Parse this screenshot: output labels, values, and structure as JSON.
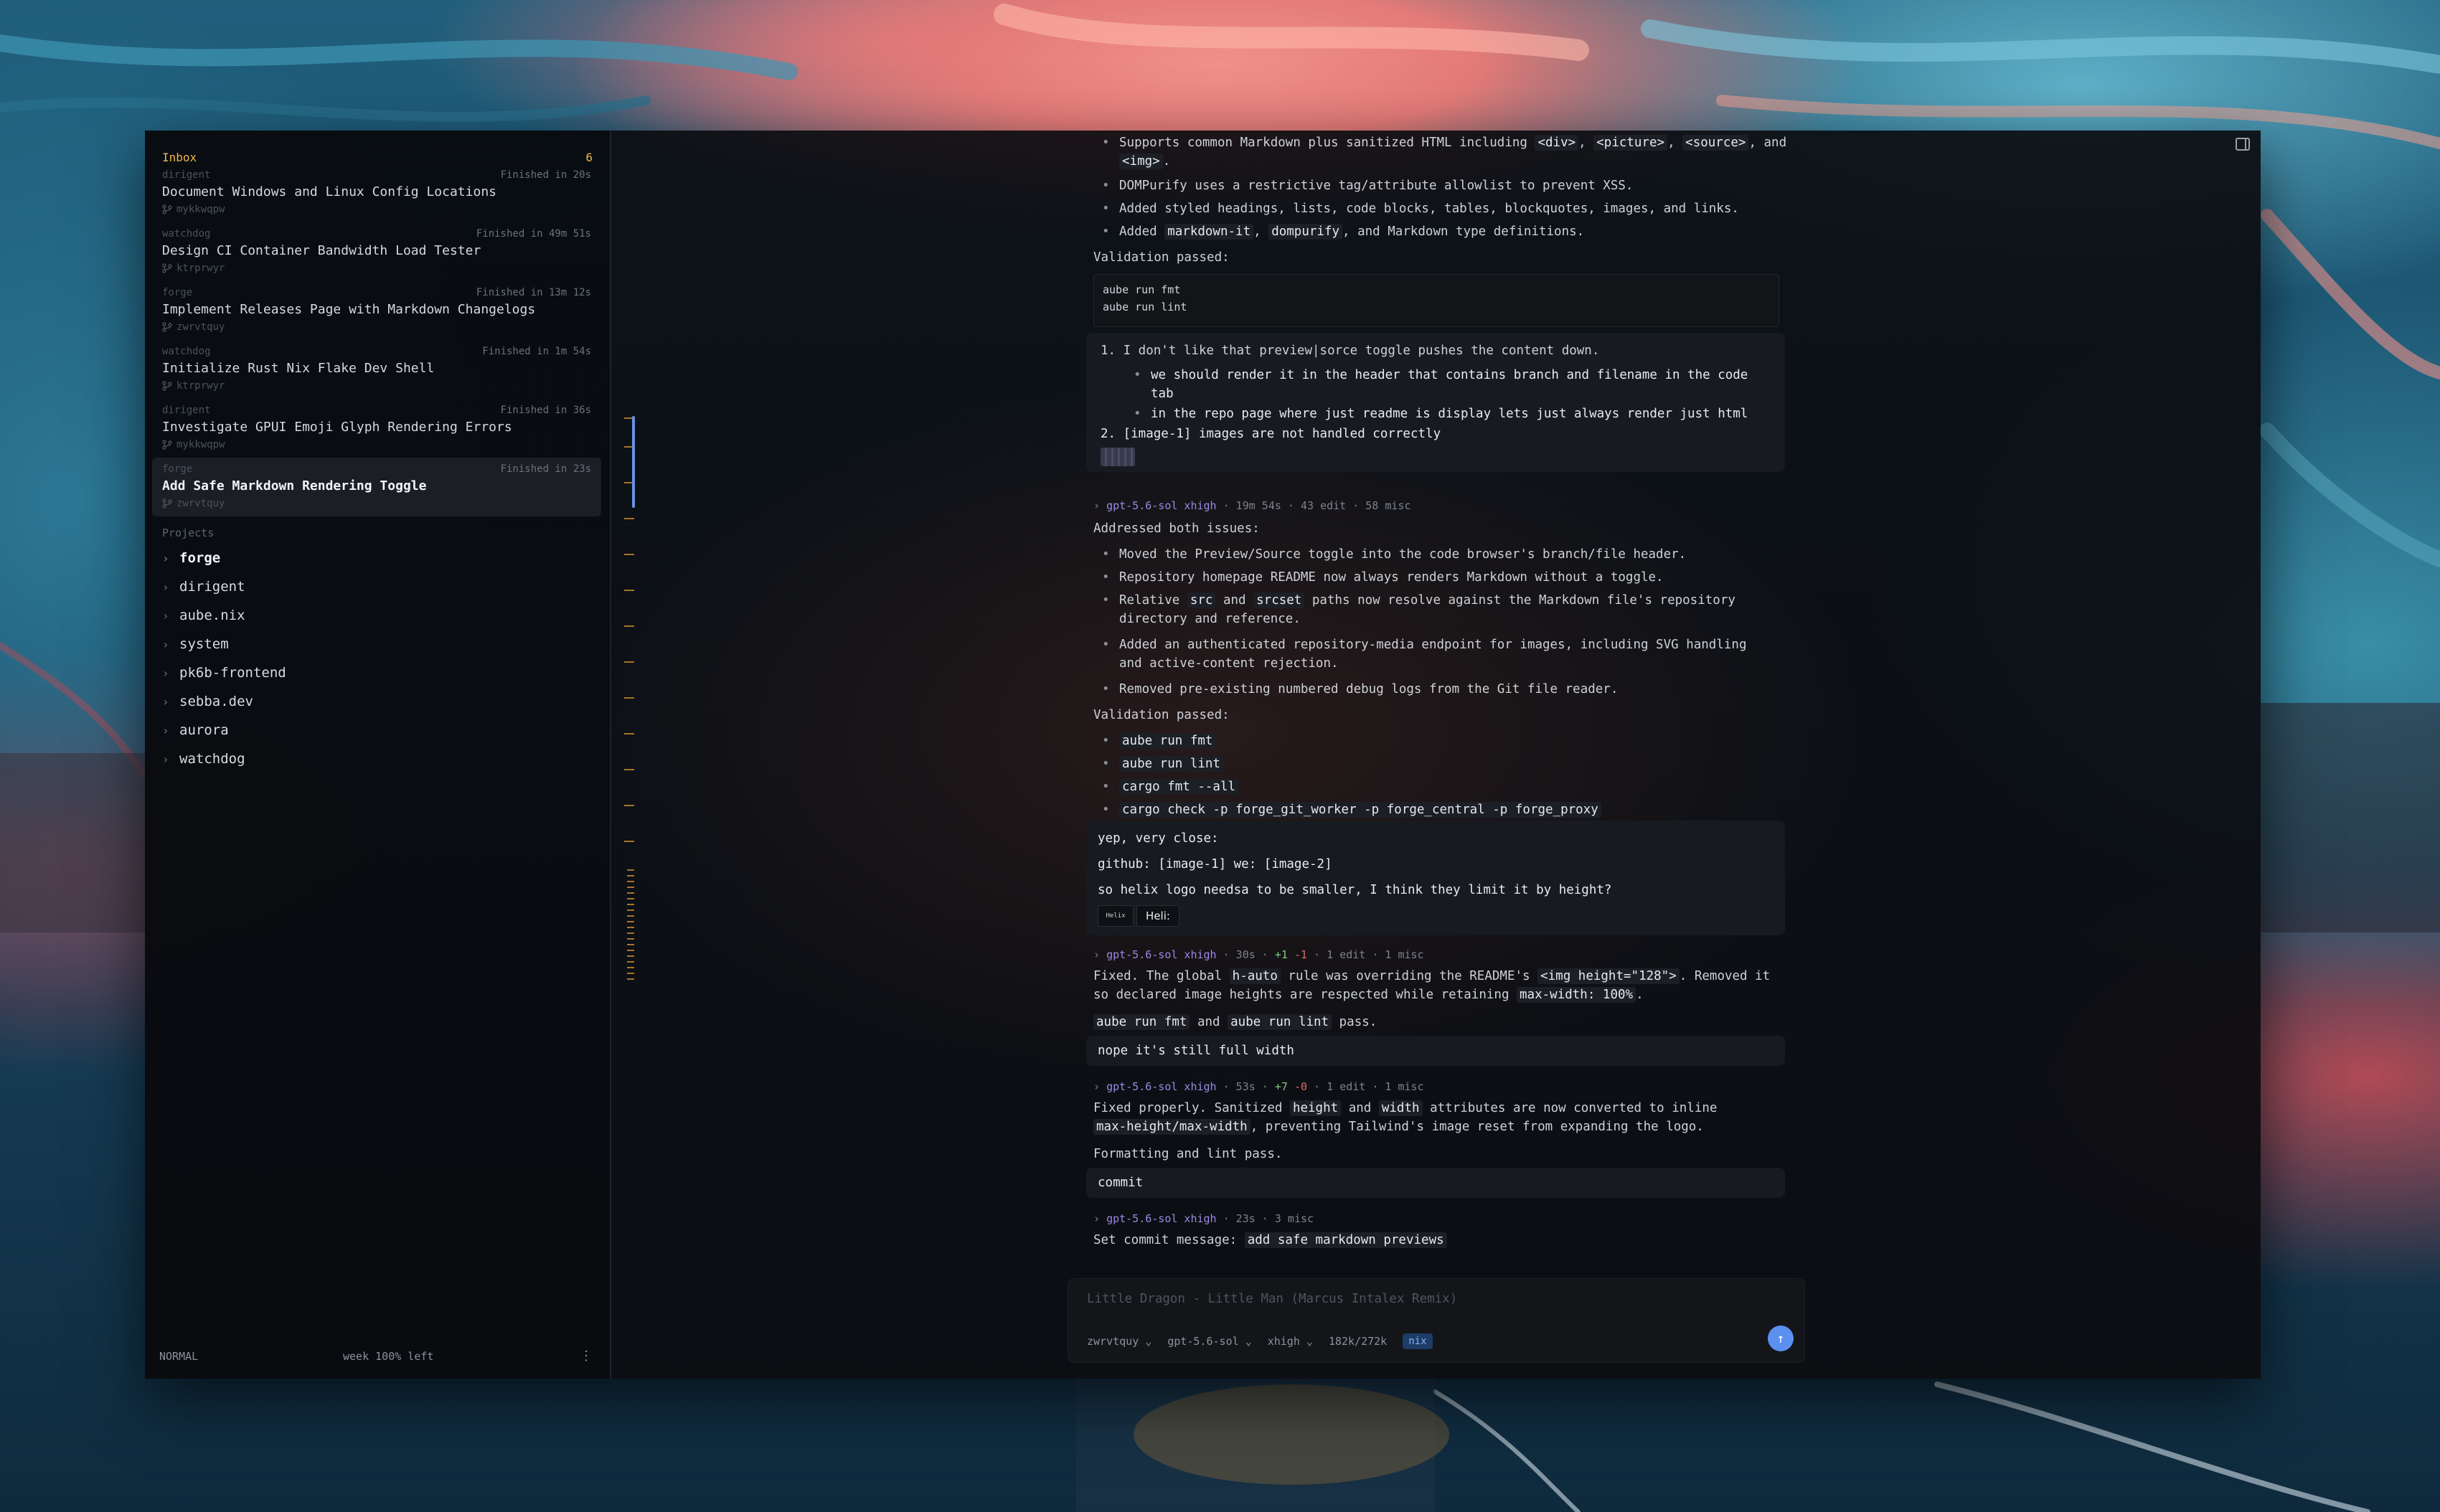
{
  "inbox": {
    "title": "Inbox",
    "count": "6",
    "items": [
      {
        "project": "dirigent",
        "status": "Finished in 20s",
        "title": "Document Windows and Linux Config Locations",
        "branch": "mykkwqpw"
      },
      {
        "project": "watchdog",
        "status": "Finished in 49m 51s",
        "title": "Design CI Container Bandwidth Load Tester",
        "branch": "ktrprwyr"
      },
      {
        "project": "forge",
        "status": "Finished in 13m 12s",
        "title": "Implement Releases Page with Markdown Changelogs",
        "branch": "zwrvtquy"
      },
      {
        "project": "watchdog",
        "status": "Finished in 1m 54s",
        "title": "Initialize Rust Nix Flake Dev Shell",
        "branch": "ktrprwyr"
      },
      {
        "project": "dirigent",
        "status": "Finished in 36s",
        "title": "Investigate GPUI Emoji Glyph Rendering Errors",
        "branch": "mykkwqpw"
      },
      {
        "project": "forge",
        "status": "Finished in 23s",
        "title": "Add Safe Markdown Rendering Toggle",
        "branch": "zwrvtquy"
      }
    ]
  },
  "projects": {
    "title": "Projects",
    "items": [
      "forge",
      "dirigent",
      "aube.nix",
      "system",
      "pk6b-frontend",
      "sebba.dev",
      "aurora",
      "watchdog"
    ]
  },
  "statusbar": {
    "mode": "NORMAL",
    "quota": "week 100% left",
    "more": "⋮"
  },
  "conversation": {
    "top_bullets": {
      "b1_l1_a": "Supports common Markdown plus sanitized HTML including ",
      "b1_code1": "<div>",
      "b1_sep1": ", ",
      "b1_code2": "<picture>",
      "b1_sep2": ", ",
      "b1_code3": "<source>",
      "b1_sep3": ", and",
      "b1_code4": "<img>",
      "b1_end": ".",
      "b2": "DOMPurify uses a restrictive tag/attribute allowlist to prevent XSS.",
      "b3": "Added styled headings, lists, code blocks, tables, blockquotes, images, and links.",
      "b4_a": "Added ",
      "b4_c1": "markdown-it",
      "b4_sep": ", ",
      "b4_c2": "dompurify",
      "b4_b": ", and Markdown type definitions."
    },
    "validation1": "Validation passed:",
    "code1": [
      "aube run fmt",
      "aube run lint"
    ],
    "user1": {
      "l1": "1. I don't like that preview|sorce toggle pushes the content down.",
      "l2": "we should render it in the header that contains branch and filename in the code",
      "l2b": "tab",
      "l3": "in the repo page where just readme is display lets just always render just html",
      "l4": "2. [image-1] images are not handled correctly"
    },
    "meta1": {
      "arrow": "›",
      "model": "gpt-5.6-sol xhigh",
      "rest": " · 19m 54s · 43 edit · 58 misc"
    },
    "resp1": {
      "intro": "Addressed both issues:",
      "b1": "Moved the Preview/Source toggle into the code browser's branch/file header.",
      "b2": "Repository homepage README now always renders Markdown without a toggle.",
      "b3_a": "Relative ",
      "b3_c1": "src",
      "b3_b": " and ",
      "b3_c2": "srcset",
      "b3_c": " paths now resolve against the Markdown file's repository",
      "b3_d": "directory and reference.",
      "b4": "Added an authenticated repository-media endpoint for images, including SVG handling",
      "b4b": "and active-content rejection.",
      "b5": "Removed pre-existing numbered debug logs from the Git file reader.",
      "validation": "Validation passed:",
      "v1": "aube run fmt",
      "v2": "aube run lint",
      "v3": "cargo fmt --all",
      "v4": "cargo check -p forge_git_worker -p forge_central -p forge_proxy"
    },
    "user2": {
      "l1": "yep, very close:",
      "l2": "github: [image-1] we: [image-2]",
      "l3": "so helix logo needsa to be smaller, I think they limit it by height?",
      "thumb1": "Helix",
      "thumb2": "Heli:"
    },
    "meta2": {
      "arrow": "›",
      "model": "gpt-5.6-sol xhigh",
      "a": " · 30s · ",
      "add": "+1",
      "sp": " ",
      "del": "-1",
      "rest": " · 1 edit · 1 misc"
    },
    "resp2": {
      "a": "Fixed. The global ",
      "c1": "h-auto",
      "b": " rule was overriding the README's ",
      "c2": "<img height=\"128\">",
      "c": ". Removed it",
      "d": "so declared image heights are respected while retaining ",
      "c3": "max-width: 100%",
      "e": ".",
      "f_c1": "aube run fmt",
      "f_b": " and ",
      "f_c2": "aube run lint",
      "f_c": " pass."
    },
    "user3": "nope it's still full width",
    "meta3": {
      "arrow": "›",
      "model": "gpt-5.6-sol xhigh",
      "a": " · 53s · ",
      "add": "+7",
      "sp": " ",
      "del": "-0",
      "rest": " · 1 edit · 1 misc"
    },
    "resp3": {
      "a": "Fixed properly. Sanitized ",
      "c1": "height",
      "b": " and ",
      "c2": "width",
      "c": " attributes are now converted to inline",
      "d_c": "max-height/max-width",
      "d": ", preventing Tailwind's image reset from expanding the logo.",
      "e": "Formatting and lint pass."
    },
    "user4": "commit",
    "meta4": {
      "arrow": "›",
      "model": "gpt-5.6-sol xhigh",
      "rest": " · 23s · 3 misc"
    },
    "resp4": {
      "a": "Set commit message: ",
      "c": "add safe markdown previews"
    }
  },
  "composer": {
    "placeholder": "Little Dragon - Little Man (Marcus Intalex Remix)",
    "branch": "zwrvtquy",
    "model": "gpt-5.6-sol",
    "effort": "xhigh",
    "tokens": "182k/272k",
    "env": "nix",
    "send": "↑"
  },
  "colors": {
    "accent": "#f0b34a",
    "model": "#9a8ae6",
    "send": "#5b8ff0",
    "add": "#7fcf7a",
    "del": "#e06a6a"
  }
}
